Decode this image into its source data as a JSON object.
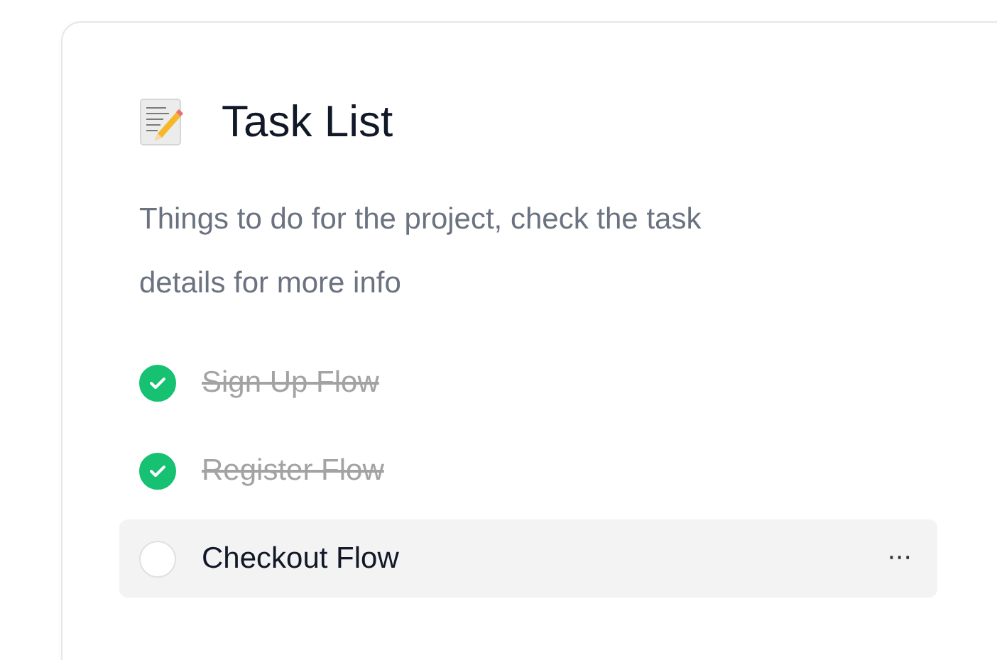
{
  "title": "Task List",
  "description": "Things to do for the project, check the task details for more info",
  "tasks": [
    {
      "label": "Sign Up Flow",
      "checked": true,
      "selected": false
    },
    {
      "label": "Register Flow",
      "checked": true,
      "selected": false
    },
    {
      "label": "Checkout Flow",
      "checked": false,
      "selected": true,
      "menu": "···"
    }
  ]
}
